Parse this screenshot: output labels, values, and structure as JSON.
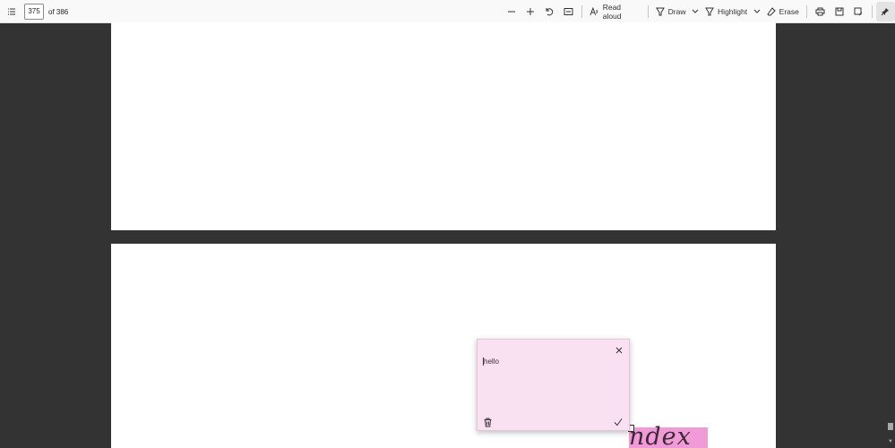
{
  "toolbar": {
    "page_current": "375",
    "page_total": "of 386",
    "read_aloud": "Read aloud",
    "draw": "Draw",
    "highlight": "Highlight",
    "erase": "Erase",
    "icons": [
      "contents-icon",
      "zoom-out-icon",
      "zoom-in-icon",
      "rotate-icon",
      "fit-page-icon",
      "read-aloud-icon",
      "draw-icon",
      "highlight-icon",
      "erase-icon",
      "print-icon",
      "save-icon",
      "save-as-icon",
      "pin-icon"
    ]
  },
  "document": {
    "highlighted_text": "ndex"
  },
  "note": {
    "text": "hello"
  },
  "colors": {
    "background": "#333333",
    "highlight": "#f19ad8",
    "note_bg": "#f9e1f1"
  }
}
